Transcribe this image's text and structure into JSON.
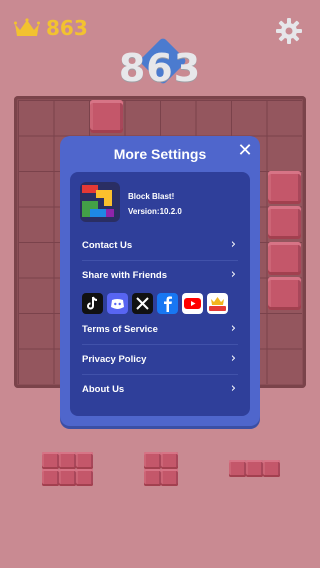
{
  "hud": {
    "best_score": "863",
    "score": "863",
    "crown_icon": "crown-icon",
    "settings_icon": "gear-icon"
  },
  "dialog": {
    "title": "More Settings",
    "close_icon": "close-icon",
    "app": {
      "name": "Block Blast!",
      "version": "Version:10.2.0"
    },
    "items": [
      {
        "label": "Contact Us"
      },
      {
        "label": "Share with Friends"
      },
      {
        "label": "Terms of Service"
      },
      {
        "label": "Privacy Policy"
      },
      {
        "label": "About Us"
      }
    ],
    "social": [
      {
        "name": "tiktok-icon",
        "color": "#111111"
      },
      {
        "name": "discord-icon",
        "color": "#5865f2"
      },
      {
        "name": "x-icon",
        "color": "#111111"
      },
      {
        "name": "facebook-icon",
        "color": "#1877f2"
      },
      {
        "name": "youtube-icon",
        "color": "#ff0000"
      },
      {
        "name": "official-icon",
        "color": "#ffffff",
        "label": "OFFICIAL"
      }
    ]
  },
  "colors": {
    "background": "#c98a92",
    "board": "#8a4e56",
    "tile": "#c4576a",
    "dialog": "#4f66cc",
    "panel": "#2f3f9a",
    "score_gold": "#f2c230"
  }
}
